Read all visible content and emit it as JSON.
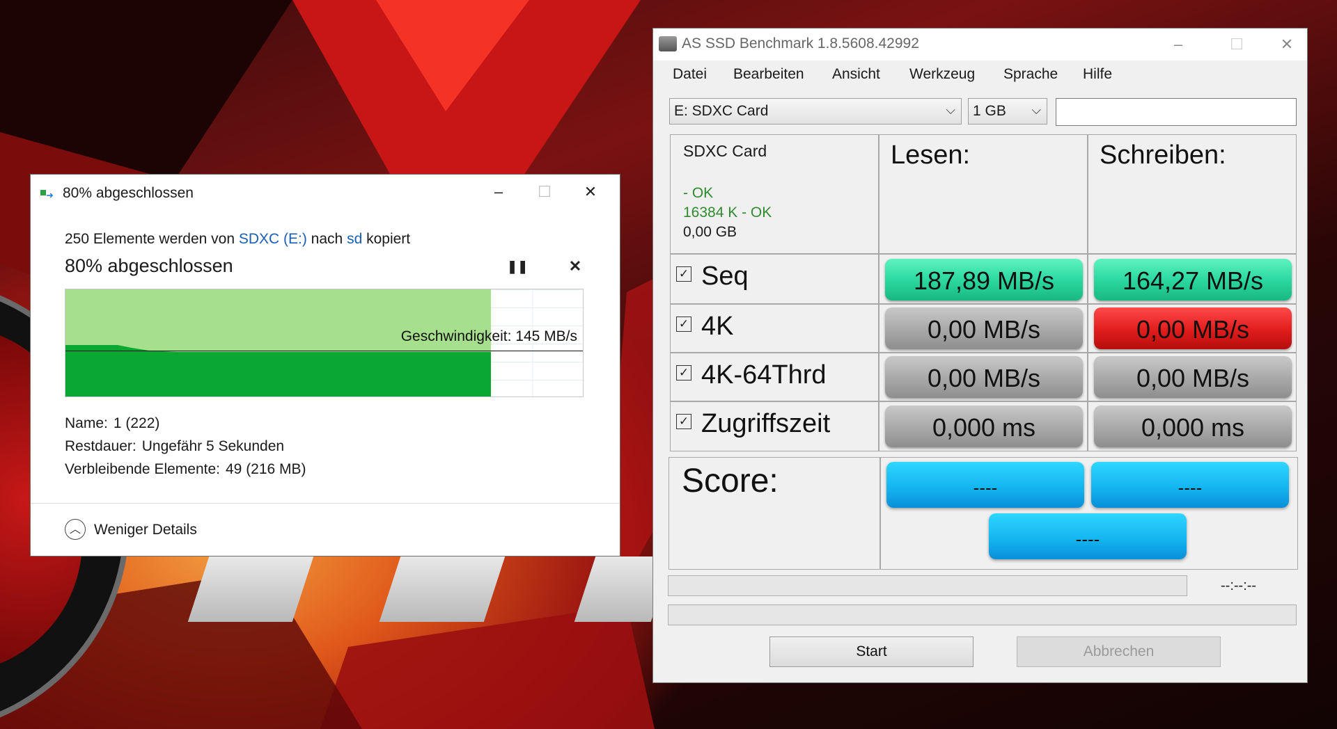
{
  "copy_dialog": {
    "title": "80% abgeschlossen",
    "line_prefix": "250 Elemente werden von ",
    "source_link": "SDXC (E:)",
    "line_middle": " nach ",
    "dest_link": "sd",
    "line_suffix": " kopiert",
    "progress_heading": "80% abgeschlossen",
    "progress_fraction": 0.82,
    "speed_label": "Geschwindigkeit: 145 MB/s",
    "name_label": "Name:",
    "name_value": "1 (222)",
    "remaining_time_label": "Restdauer:",
    "remaining_time_value": "Ungefähr 5 Sekunden",
    "remaining_items_label": "Verbleibende Elemente:",
    "remaining_items_value": "49 (216 MB)",
    "less_details": "Weniger Details",
    "colors": {
      "done_fill": "#a6e08d",
      "transfer_fill": "#0aa832"
    }
  },
  "ssd_benchmark": {
    "title": "AS SSD Benchmark 1.8.5608.42992",
    "menu": [
      "Datei",
      "Bearbeiten",
      "Ansicht",
      "Werkzeug",
      "Sprache",
      "Hilfe"
    ],
    "drive_select": "E: SDXC Card",
    "size_select": "1 GB",
    "drive_info": {
      "name": "SDXC Card",
      "status1": "- OK",
      "status2": "16384 K - OK",
      "size": "0,00 GB"
    },
    "col_read": "Lesen:",
    "col_write": "Schreiben:",
    "rows": [
      {
        "label": "Seq",
        "read": "187,89 MB/s",
        "write": "164,27 MB/s"
      },
      {
        "label": "4K",
        "read": "0,00 MB/s",
        "write": "0,00 MB/s"
      },
      {
        "label": "4K-64Thrd",
        "read": "0,00 MB/s",
        "write": "0,00 MB/s"
      },
      {
        "label": "Zugriffszeit",
        "read": "0,000 ms",
        "write": "0,000 ms"
      }
    ],
    "score_label": "Score:",
    "score_read": "----",
    "score_write": "----",
    "score_total": "----",
    "elapsed": "--:--:--",
    "start_button": "Start",
    "cancel_button": "Abbrechen",
    "colors": {
      "good": "#2cd9a0",
      "error": "#e11c1c",
      "idle": "#a8a8a8",
      "score": "#14b6f0"
    }
  }
}
